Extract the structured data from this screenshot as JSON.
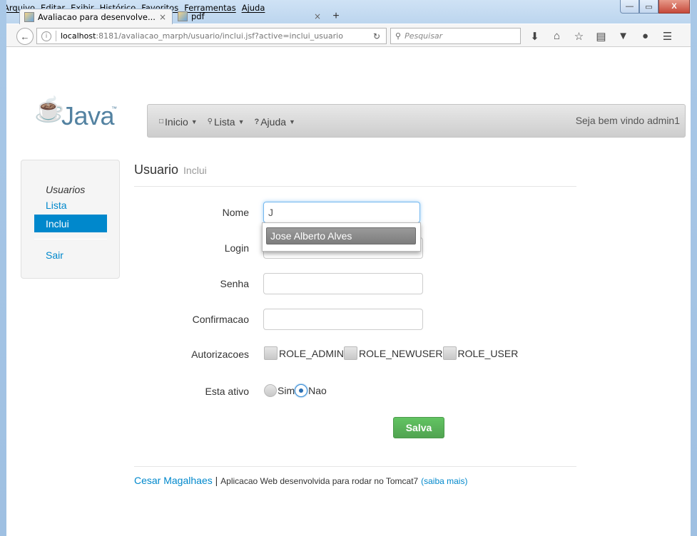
{
  "browser": {
    "menu": [
      "Arquivo",
      "Editar",
      "Exibir",
      "Histórico",
      "Favoritos",
      "Ferramentas",
      "Ajuda"
    ],
    "tabs": [
      {
        "title": "Avaliacao para desenvolve...",
        "close": "×"
      },
      {
        "title": "pdf",
        "close": "×"
      }
    ],
    "new_tab": "+",
    "url_host": "localhost",
    "url_path": ":8181/avaliacao_marph/usuario/inclui.jsf?active=inclui_usuario",
    "search_placeholder": "Pesquisar",
    "window_buttons": {
      "minimize": "—",
      "maximize": "▭",
      "close": "X"
    }
  },
  "app": {
    "logo_text": "Java",
    "nav": [
      {
        "label": "Inicio",
        "icon": "document-icon"
      },
      {
        "label": "Lista",
        "icon": "search-icon"
      },
      {
        "label": "Ajuda",
        "icon": "question-icon"
      }
    ],
    "welcome": "Seja bem vindo admin1"
  },
  "sidebar": {
    "title": "Usuarios",
    "items": [
      {
        "label": "Lista",
        "active": false
      },
      {
        "label": "Inclui",
        "active": true
      },
      {
        "label": "Sair",
        "active": false
      }
    ]
  },
  "form": {
    "header": "Usuario",
    "subheader": "Inclui",
    "fields": {
      "nome": {
        "label": "Nome",
        "value": "J"
      },
      "login": {
        "label": "Login",
        "value": ""
      },
      "senha": {
        "label": "Senha",
        "value": ""
      },
      "confirmacao": {
        "label": "Confirmacao",
        "value": ""
      }
    },
    "autocomplete_suggestion": "Jose Alberto Alves",
    "autorizacoes": {
      "label": "Autorizacoes",
      "options": [
        "ROLE_ADMIN",
        "ROLE_NEWUSER",
        "ROLE_USER"
      ]
    },
    "ativo": {
      "label": "Esta ativo",
      "options": [
        "Sim",
        "Nao"
      ],
      "selected": "Nao"
    },
    "save_label": "Salva"
  },
  "footer": {
    "author": "Cesar Magalhaes",
    "separator": "|",
    "description": "Aplicacao Web desenvolvida para rodar no Tomcat7",
    "more_link": "saiba mais"
  },
  "colors": {
    "link": "#0088cc",
    "save_button": "#5bb75b",
    "chrome": "#bcd5ee"
  }
}
